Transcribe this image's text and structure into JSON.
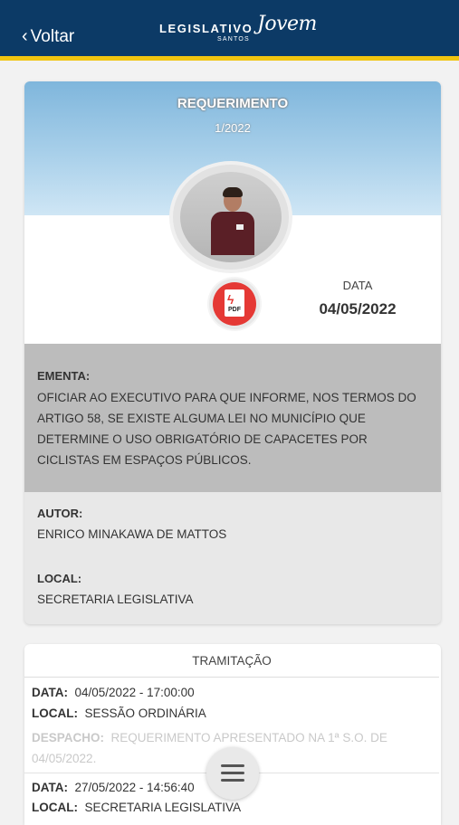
{
  "header": {
    "back_label": "Voltar",
    "logo_main": "LEGISLATIVO",
    "logo_script": "Jovem",
    "logo_sub": "SANTOS"
  },
  "card": {
    "title": "REQUERIMENTO",
    "number": "1/2022",
    "pdf_label": "PDF",
    "date_label": "DATA",
    "date_value": "04/05/2022",
    "ementa_label": "EMENTA:",
    "ementa_text": "OFICIAR AO EXECUTIVO PARA QUE INFORME, NOS TERMOS DO ARTIGO 58, SE EXISTE ALGUMA LEI NO MUNICÍPIO QUE DETERMINE O USO OBRIGATÓRIO DE CAPACETES POR CICLISTAS EM ESPAÇOS PÚBLICOS.",
    "autor_label": "AUTOR:",
    "autor_value": "ENRICO MINAKAWA DE MATTOS",
    "local_label": "LOCAL:",
    "local_value": "SECRETARIA LEGISLATIVA"
  },
  "tramitacao": {
    "title": "TRAMITAÇÃO",
    "entries": [
      {
        "data_label": "DATA:",
        "data_value": "04/05/2022 - 17:00:00",
        "local_label": "LOCAL:",
        "local_value": "SESSÃO ORDINÁRIA",
        "despacho_label": "DESPACHO:",
        "despacho_value": "REQUERIMENTO APRESENTADO NA 1ª S.O. DE 04/05/2022."
      },
      {
        "data_label": "DATA:",
        "data_value": "27/05/2022 - 14:56:40",
        "local_label": "LOCAL:",
        "local_value": "SECRETARIA LEGISLATIVA"
      }
    ]
  },
  "icons": {
    "back": "chevron-left-icon",
    "pdf": "pdf-icon",
    "menu": "hamburger-menu-icon"
  },
  "colors": {
    "header_bg": "#0c3a66",
    "header_accent": "#f1c40f",
    "pdf_red": "#e53935"
  }
}
